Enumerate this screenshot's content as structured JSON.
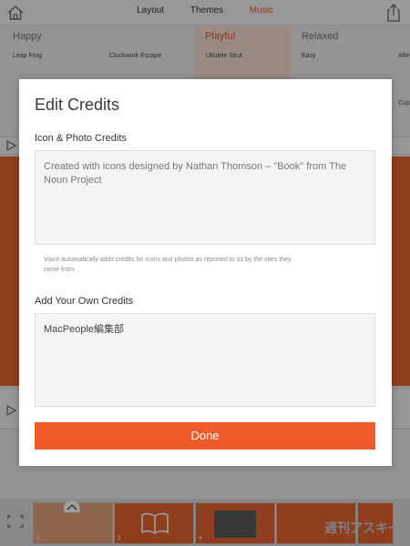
{
  "topbar": {
    "tabs": [
      "Layout",
      "Themes",
      "Music"
    ],
    "active_tab": "Music"
  },
  "moods": [
    "Happy",
    "Playful",
    "Relaxed"
  ],
  "tracks": {
    "row1": [
      "Leap Frog",
      "Clockwork Escape",
      "Ukulele Strut",
      "Easy",
      "Afte"
    ],
    "row2_partial": [
      "Cup"
    ]
  },
  "modal": {
    "title": "Edit Credits",
    "icon_section_label": "Icon & Photo Credits",
    "icon_credits_text": "Created with icons designed by Nathan Thomson – \"Book\" from The Noun Project",
    "helper_text": "Voice automatically adds credits for icons and photos as reported to us by the sites they come from.",
    "own_section_label": "Add Your Own Credits",
    "own_credits_text": "MacPeople編集部",
    "done_label": "Done"
  },
  "thumbnails": [
    "2",
    "3",
    "4"
  ],
  "watermark": "週刊アスキー",
  "colors": {
    "accent": "#ee5a2a",
    "slide": "#e7642f"
  }
}
